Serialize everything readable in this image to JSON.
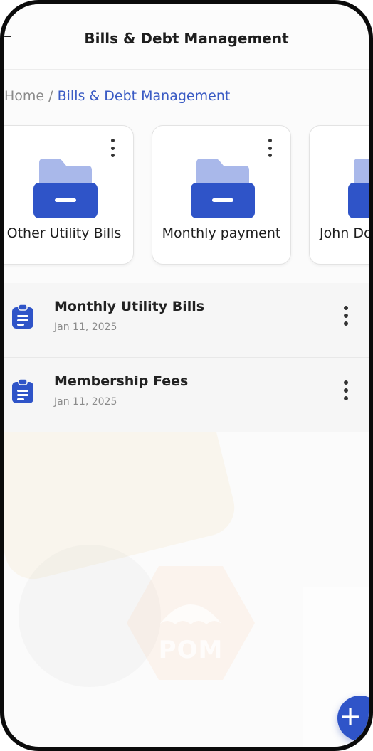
{
  "header": {
    "title": "Bills & Debt Management"
  },
  "breadcrumb": {
    "home": "Home",
    "separator": "/",
    "current": "Bills & Debt Management"
  },
  "folders": [
    {
      "label": "Other Utility Bills",
      "icon": "folder-icon"
    },
    {
      "label": "Monthly payment",
      "icon": "folder-icon"
    },
    {
      "label": "John Do",
      "icon": "folder-icon"
    }
  ],
  "documents": [
    {
      "title": "Monthly Utility Bills",
      "date": "Jan 11, 2025",
      "icon": "document-icon"
    },
    {
      "title": "Membership Fees",
      "date": "Jan 11, 2025",
      "icon": "document-icon"
    }
  ],
  "background": {
    "logo_text": "POM"
  },
  "fab": {
    "icon": "plus-icon",
    "label": "+"
  },
  "colors": {
    "accent": "#2f54c8",
    "folder_back": "#a9b8ea",
    "folder_front": "#2f54c8",
    "breadcrumb_active": "#3a5bc4"
  }
}
